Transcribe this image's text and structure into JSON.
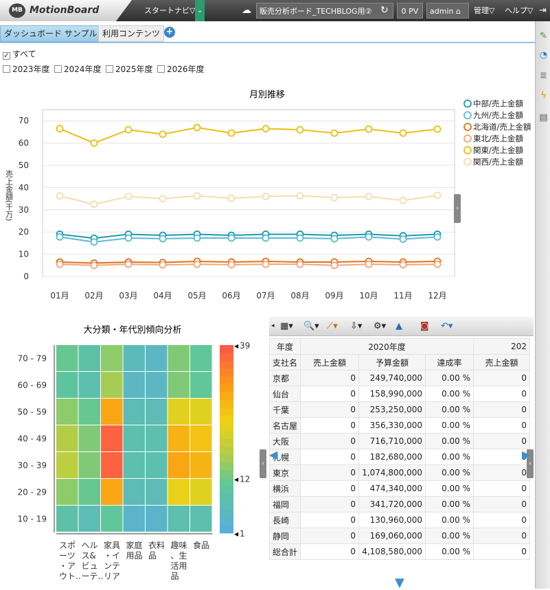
{
  "header": {
    "logo_badge": "MB",
    "logo": "MotionBoard",
    "start_navi": "スタートナビ▽",
    "board": "販売分析ボード_TECHBLOG用②",
    "pv": "0 PV",
    "user": "admin",
    "admin": "管理▽",
    "help": "ヘルプ▽"
  },
  "tabs": [
    "ダッシュボード サンプル",
    "利用コンテンツ"
  ],
  "filters": {
    "all": "すべて",
    "years": [
      "2023年度",
      "2024年度",
      "2025年度",
      "2026年度"
    ]
  },
  "line": {
    "title": "月別推移",
    "ylabel": "売上金額(千万)"
  },
  "heatmap": {
    "title": "大分類・年代別傾向分析"
  },
  "table": {
    "h_year": "年度",
    "h_2020": "2020年度",
    "h_202": "202",
    "h_branch": "支社名",
    "cols": [
      "売上金額",
      "予算金額",
      "達成率",
      "売上金額"
    ],
    "rows": [
      [
        "京都",
        "0",
        "249,740,000",
        "0.00 %",
        "0"
      ],
      [
        "仙台",
        "0",
        "158,990,000",
        "0.00 %",
        "0"
      ],
      [
        "千葉",
        "0",
        "253,250,000",
        "0.00 %",
        "0"
      ],
      [
        "名古屋",
        "0",
        "356,330,000",
        "0.00 %",
        "0"
      ],
      [
        "大阪",
        "0",
        "716,710,000",
        "0.00 %",
        "0"
      ],
      [
        "札幌",
        "0",
        "182,680,000",
        "0.00 %",
        "0"
      ],
      [
        "東京",
        "0",
        "1,074,800,000",
        "0.00 %",
        "0"
      ],
      [
        "横浜",
        "0",
        "474,340,000",
        "0.00 %",
        "0"
      ],
      [
        "福岡",
        "0",
        "341,720,000",
        "0.00 %",
        "0"
      ],
      [
        "長崎",
        "0",
        "130,960,000",
        "0.00 %",
        "0"
      ],
      [
        "静岡",
        "0",
        "169,060,000",
        "0.00 %",
        "0"
      ],
      [
        "総合計",
        "0",
        "4,108,580,000",
        "0.00 %",
        "0"
      ]
    ]
  },
  "chart_data": [
    {
      "type": "line",
      "title": "月別推移",
      "ylabel": "売上金額(千万)",
      "xlabel": "",
      "ylim": [
        0,
        75
      ],
      "yticks": [
        0,
        10,
        20,
        30,
        40,
        50,
        60,
        70
      ],
      "legend": "right",
      "x": [
        "01月",
        "02月",
        "03月",
        "04月",
        "05月",
        "06月",
        "07月",
        "08月",
        "09月",
        "10月",
        "11月",
        "12月"
      ],
      "series": [
        {
          "name": "中部/売上金額",
          "color": "#1a9aa8",
          "values": [
            19,
            17.2,
            19,
            18.5,
            19,
            18.5,
            19,
            19,
            18.5,
            19,
            18.3,
            19
          ]
        },
        {
          "name": "九州/売上金額",
          "color": "#5bbad6",
          "values": [
            17.8,
            15.5,
            17.3,
            17,
            17.3,
            17.3,
            17.3,
            17.3,
            17,
            17.8,
            16.8,
            17.8
          ]
        },
        {
          "name": "北海道/売上金額",
          "color": "#e0701a",
          "values": [
            6.5,
            6,
            6.5,
            6.3,
            6.8,
            6.5,
            6.8,
            6.5,
            6.5,
            6.8,
            6.5,
            6.8
          ]
        },
        {
          "name": "東北/売上金額",
          "color": "#f0a57a",
          "values": [
            5.5,
            5,
            5.5,
            5.2,
            5.5,
            5.3,
            5.5,
            5.5,
            5,
            5.5,
            5.3,
            5.5
          ]
        },
        {
          "name": "関東/売上金額",
          "color": "#e8c010",
          "values": [
            66.5,
            60,
            66,
            64,
            67,
            64.5,
            66.5,
            66,
            64.5,
            66.3,
            64.5,
            66.3
          ]
        },
        {
          "name": "関西/売上金額",
          "color": "#f2deae",
          "values": [
            36.2,
            32.5,
            36,
            35,
            36.3,
            35.2,
            36,
            36.3,
            35.5,
            36,
            34.2,
            36.5
          ]
        }
      ]
    },
    {
      "type": "heatmap",
      "title": "大分類・年代別傾向分析",
      "y": [
        "70 - 79",
        "60 - 69",
        "50 - 59",
        "40 - 49",
        "30 - 39",
        "20 - 29",
        "10 - 19"
      ],
      "x": [
        "スポーツ・アウト..",
        "ヘルス&ビューテ..",
        "家具・インテリア",
        "家庭用品",
        "衣料品",
        "趣味、生活用品",
        "食品"
      ],
      "x_display": [
        [
          "スポ",
          "ーツ",
          "・ア",
          "ウト.."
        ],
        [
          "ヘル",
          "ス&",
          "ビュ",
          "ーテ.."
        ],
        [
          "家具",
          "・イ",
          "ンテ",
          "リア"
        ],
        [
          "家庭",
          "用品"
        ],
        [
          "衣料",
          "品"
        ],
        [
          "趣味",
          "、生",
          "活用",
          "品"
        ],
        [
          "食品"
        ]
      ],
      "scale": {
        "min": 1,
        "mid": 12,
        "max": 39,
        "labels": [
          "39",
          "12",
          "1"
        ]
      },
      "values": [
        [
          11,
          8,
          14,
          5,
          4,
          13,
          10
        ],
        [
          9,
          7,
          16,
          4,
          4,
          13,
          10
        ],
        [
          14,
          11,
          30,
          6,
          6,
          22,
          22
        ],
        [
          17,
          13,
          38,
          7,
          7,
          28,
          26
        ],
        [
          18,
          13,
          38,
          7,
          7,
          30,
          28
        ],
        [
          14,
          11,
          30,
          6,
          6,
          23,
          22
        ],
        [
          8,
          6,
          10,
          3,
          3,
          7,
          7
        ]
      ]
    }
  ]
}
